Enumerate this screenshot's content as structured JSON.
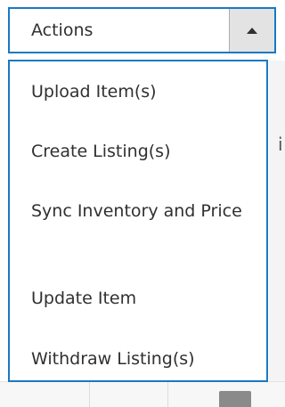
{
  "actions": {
    "label": "Actions",
    "toggle_icon": "caret-up-icon"
  },
  "menu": {
    "items": [
      {
        "label": "Upload Item(s)"
      },
      {
        "label": "Create Listing(s)"
      },
      {
        "label": "Sync Inventory and Price"
      },
      {
        "label": "Update Item"
      },
      {
        "label": "Withdraw Listing(s)"
      }
    ]
  },
  "background": {
    "glyph": "i"
  },
  "colors": {
    "accent_border": "#1979c3",
    "text": "#303030",
    "toggle_bg": "#e3e3e3"
  }
}
